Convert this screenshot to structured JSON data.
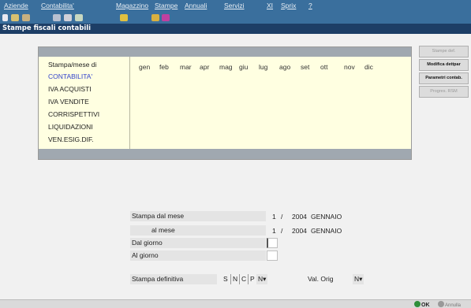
{
  "menu": {
    "items": [
      "Aziende",
      "Contabilita'",
      "Magazzino",
      "Stampe",
      "Annuali",
      "Servizi",
      "XI",
      "Sprix",
      "?"
    ]
  },
  "toolbar": {
    "icons": [
      "cut-icon",
      "copy-icon",
      "paste-icon",
      "edit-icon",
      "print-icon",
      "email-icon",
      "calculator-icon",
      "tools-icon",
      "link-icon"
    ]
  },
  "window": {
    "title": "Stampe fiscali contabili"
  },
  "grid": {
    "header": "Stampa/mese di",
    "rows": [
      "CONTABILITA'",
      "IVA ACQUISTI",
      "IVA VENDITE",
      "CORRISPETTIVI",
      "LIQUIDAZIONI",
      "VEN.ESIG.DIF."
    ],
    "months": [
      "gen",
      "feb",
      "mar",
      "apr",
      "mag",
      "giu",
      "lug",
      "ago",
      "set",
      "ott",
      "nov",
      "dic"
    ]
  },
  "side_buttons": [
    "Stampe def.",
    "Modifica dettpar",
    "Parametri contab.",
    "Progres. RSM"
  ],
  "form": {
    "dal_mese": {
      "label": "Stampa  dal mese",
      "month": "1",
      "sep": "/",
      "year": "2004",
      "name": "GENNAIO"
    },
    "al_mese": {
      "label": "al mese",
      "month": "1",
      "sep": "/",
      "year": "2004",
      "name": "GENNAIO"
    },
    "dal_giorno": {
      "label": "Dal giorno"
    },
    "al_giorno": {
      "label": "Al giorno"
    },
    "definitiva": {
      "label": "Stampa definitiva",
      "options": [
        "S",
        "N",
        "C",
        "P"
      ],
      "selected": "N"
    },
    "val_orig": {
      "label": "Val. Orig",
      "selected": "N"
    }
  },
  "status": {
    "ok": "OK",
    "back": "Annulla"
  },
  "colors": {
    "menubar": "#3a6f9d",
    "titlebar": "#1d3e66",
    "grid_bg": "#ffffe1",
    "active_row": "#3344cc"
  }
}
